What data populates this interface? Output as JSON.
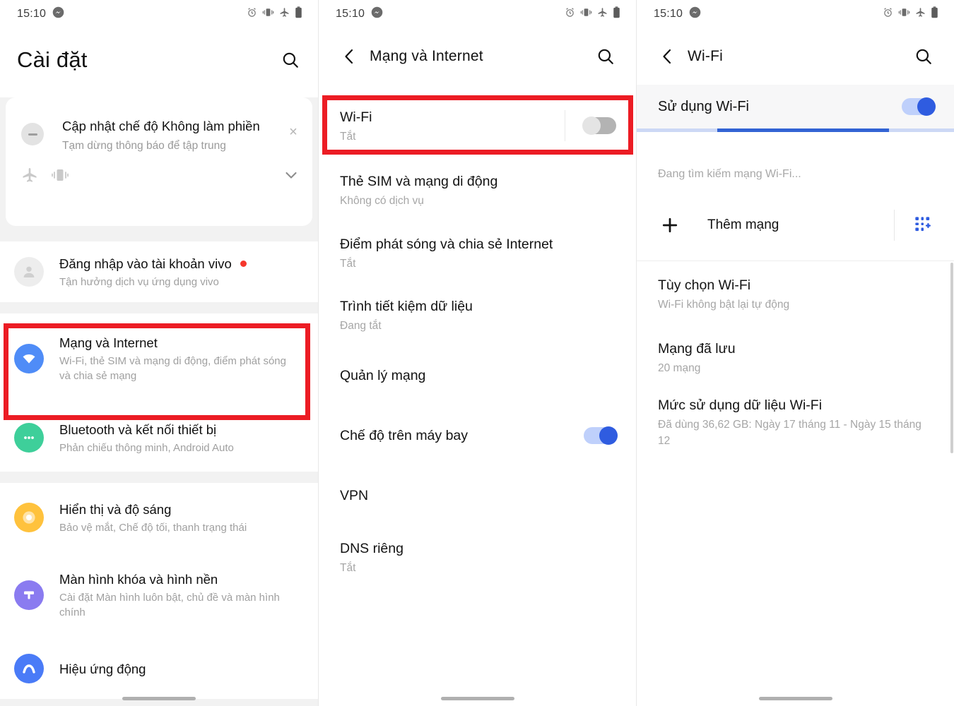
{
  "status_bar": {
    "time": "15:10",
    "icons_left": [
      "messenger-icon"
    ],
    "icons_right": [
      "alarm-icon",
      "vibrate-icon",
      "airplane-icon",
      "battery-icon"
    ]
  },
  "colors": {
    "highlight": "#ec1c24",
    "accent_blue": "#2f5ce0",
    "progress_track": "#ccd8f5",
    "progress_fill": "#3263d4",
    "badge_red": "#f5372c"
  },
  "panel1": {
    "title": "Cài đặt",
    "search_icon": "search-icon",
    "notification": {
      "title": "Cập nhật chế độ Không làm phiền",
      "subtitle": "Tạm dừng thông báo để tập trung",
      "close_label": "×",
      "icons": [
        "airplane-icon",
        "vibrate-icon"
      ],
      "expand_icon": "chevron-down-icon"
    },
    "items": [
      {
        "title": "Đăng nhập vào tài khoản vivo",
        "subtitle": "Tận hưởng dịch vụ ứng dụng vivo",
        "icon": "account-icon",
        "badge": true
      },
      {
        "title": "Mạng và Internet",
        "subtitle": "Wi-Fi, thẻ SIM và mạng di động, điểm phát sóng và chia sẻ mạng",
        "icon": "wifi-icon",
        "highlighted": true
      },
      {
        "title": "Bluetooth và kết nối thiết bị",
        "subtitle": "Phản chiếu thông minh, Android Auto",
        "icon": "bluetooth-icon"
      },
      {
        "title": "Hiển thị và độ sáng",
        "subtitle": "Bảo vệ mắt, Chế độ tối, thanh trạng thái",
        "icon": "display-icon"
      },
      {
        "title": "Màn hình khóa và hình nền",
        "subtitle": "Cài đặt Màn hình luôn bật, chủ đề và màn hình chính",
        "icon": "lockscreen-icon"
      },
      {
        "title": "Hiệu ứng động",
        "subtitle": "",
        "icon": "animation-icon"
      }
    ]
  },
  "panel2": {
    "title": "Mạng và Internet",
    "back_icon": "back-chevron-icon",
    "search_icon": "search-icon",
    "items": [
      {
        "title": "Wi-Fi",
        "subtitle": "Tắt",
        "toggle": "off",
        "highlighted": true
      },
      {
        "title": "Thẻ SIM và mạng di động",
        "subtitle": "Không có dịch vụ"
      },
      {
        "title": "Điểm phát sóng và chia sẻ Internet",
        "subtitle": "Tắt"
      },
      {
        "title": "Trình tiết kiệm dữ liệu",
        "subtitle": "Đang tắt"
      },
      {
        "title": "Quản lý mạng",
        "subtitle": ""
      },
      {
        "title": "Chế độ trên máy bay",
        "subtitle": "",
        "toggle": "on"
      },
      {
        "title": "VPN",
        "subtitle": ""
      },
      {
        "title": "DNS riêng",
        "subtitle": "Tắt"
      }
    ]
  },
  "panel3": {
    "title": "Wi-Fi",
    "back_icon": "back-chevron-icon",
    "search_icon": "search-icon",
    "use_wifi": {
      "label": "Sử dụng Wi-Fi",
      "toggle": "on"
    },
    "scanning_text": "Đang tìm kiếm mạng Wi-Fi...",
    "add_network": {
      "label": "Thêm mạng",
      "plus_icon": "plus-icon",
      "qr_icon": "qr-scan-icon"
    },
    "items": [
      {
        "title": "Tùy chọn Wi-Fi",
        "subtitle": "Wi-Fi không bật lại tự động"
      },
      {
        "title": "Mạng đã lưu",
        "subtitle": "20 mạng"
      },
      {
        "title": "Mức sử dụng dữ liệu Wi-Fi",
        "subtitle": "Đã dùng 36,62 GB: Ngày 17 tháng 11 - Ngày 15 tháng 12"
      }
    ]
  }
}
